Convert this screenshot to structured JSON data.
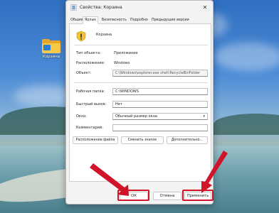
{
  "desktop": {
    "icon_label": "Корзина"
  },
  "dialog": {
    "title": "Свойства: Корзина",
    "close_glyph": "✕",
    "tabs": [
      "Общие",
      "Ярлык",
      "Безопасность",
      "Подробно",
      "Предыдущие версии"
    ],
    "active_tab": "Ярлык",
    "name": "Корзина",
    "fields": {
      "target_type_label": "Тип объекта:",
      "target_type_value": "Приложение",
      "location_label": "Расположение:",
      "location_value": "Windows",
      "target_label": "Объект:",
      "target_value": "C:\\Windows\\explorer.exe shell:RecycleBinFolder",
      "start_in_label": "Рабочая папка:",
      "start_in_value": "C:\\WINDOWS",
      "shortcut_key_label": "Быстрый вызов:",
      "shortcut_key_value": "Нет",
      "run_label": "Окно:",
      "run_value": "Обычный размер окна",
      "comment_label": "Комментарий:",
      "comment_value": ""
    },
    "buttons": {
      "open_location": "Расположение файла",
      "change_icon": "Сменить значок",
      "advanced": "Дополнительно...",
      "ok": "ОК",
      "cancel": "Отмена",
      "apply": "Применить"
    }
  },
  "colors": {
    "highlight": "#d2142a"
  }
}
